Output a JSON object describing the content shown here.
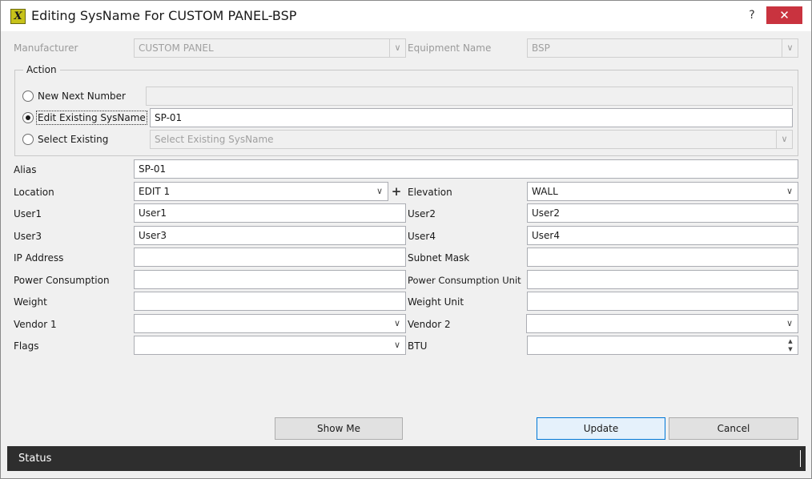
{
  "window": {
    "title": "Editing SysName For CUSTOM PANEL-BSP",
    "icon_glyph": "X",
    "help_label": "?",
    "close_label": "✕"
  },
  "top": {
    "manufacturer_label": "Manufacturer",
    "manufacturer_value": "CUSTOM PANEL",
    "equipment_label": "Equipment Name",
    "equipment_value": "BSP"
  },
  "action": {
    "group_title": "Action",
    "new_next_number_label": "New Next Number",
    "new_next_number_value": "",
    "edit_existing_label": "Edit Existing SysName",
    "edit_existing_value": "SP-01",
    "select_existing_label": "Select Existing",
    "select_existing_placeholder": "Select Existing SysName",
    "selected": "edit_existing"
  },
  "form": {
    "alias_label": "Alias",
    "alias_value": "SP-01",
    "location_label": "Location",
    "location_value": "EDIT 1",
    "location_add_glyph": "+",
    "elevation_label": "Elevation",
    "elevation_value": "WALL",
    "user1_label": "User1",
    "user1_value": "User1",
    "user2_label": "User2",
    "user2_value": "User2",
    "user3_label": "User3",
    "user3_value": "User3",
    "user4_label": "User4",
    "user4_value": "User4",
    "ip_label": "IP Address",
    "ip_value": "",
    "subnet_label": "Subnet Mask",
    "subnet_value": "",
    "power_label": "Power Consumption",
    "power_value": "",
    "power_unit_label": "Power Consumption Unit",
    "power_unit_value": "",
    "weight_label": "Weight",
    "weight_value": "",
    "weight_unit_label": "Weight Unit",
    "weight_unit_value": "",
    "vendor1_label": "Vendor 1",
    "vendor1_value": "",
    "vendor2_label": "Vendor 2",
    "vendor2_value": "",
    "flags_label": "Flags",
    "flags_value": "",
    "btu_label": "BTU",
    "btu_value": ""
  },
  "buttons": {
    "show_me": "Show Me",
    "update": "Update",
    "cancel": "Cancel"
  },
  "status": {
    "text": "Status"
  },
  "icons": {
    "dropdown": "chevron-down-icon",
    "spinner": "spin-up-down-icon",
    "add": "plus-icon",
    "app": "app-logo-icon"
  },
  "colors": {
    "close_button": "#c9333f",
    "status_bar": "#2e2e2e",
    "app_icon": "#c7c21a",
    "default_button_border": "#0078d7"
  }
}
